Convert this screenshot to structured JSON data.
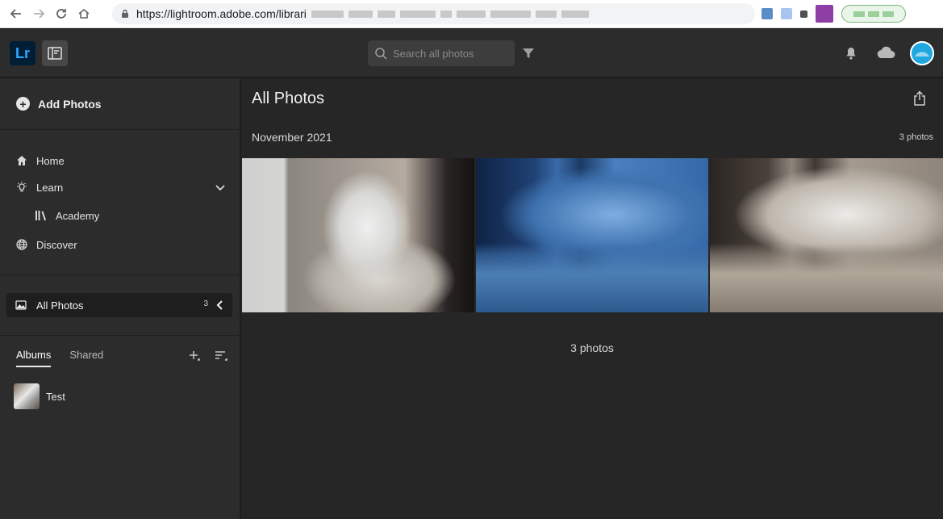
{
  "browser": {
    "url": "https://lightroom.adobe.com/librari"
  },
  "header": {
    "logo": "Lr",
    "search_placeholder": "Search all photos"
  },
  "sidebar": {
    "add_photos": "Add Photos",
    "nav": [
      {
        "label": "Home",
        "icon": "home-icon"
      },
      {
        "label": "Learn",
        "icon": "lightbulb-icon"
      },
      {
        "label": "Academy",
        "icon": "library-icon"
      },
      {
        "label": "Discover",
        "icon": "globe-icon"
      }
    ],
    "all_photos": {
      "label": "All Photos",
      "count": "3"
    },
    "tabs": {
      "albums": "Albums",
      "shared": "Shared"
    },
    "albums": [
      {
        "name": "Test"
      }
    ]
  },
  "main": {
    "title": "All Photos",
    "month": "November 2021",
    "month_count": "3 photos",
    "footer_count": "3 photos",
    "photos": [
      {
        "subject": "white cylindrical lamp on bowl"
      },
      {
        "subject": "kitchen lit in blue tone"
      },
      {
        "subject": "kitchen with warm lighting"
      }
    ]
  },
  "colors": {
    "brand_lr": "#31a8ff",
    "brand_lr_bg": "#001e36",
    "avatar_ring": "#1ea7e1"
  }
}
